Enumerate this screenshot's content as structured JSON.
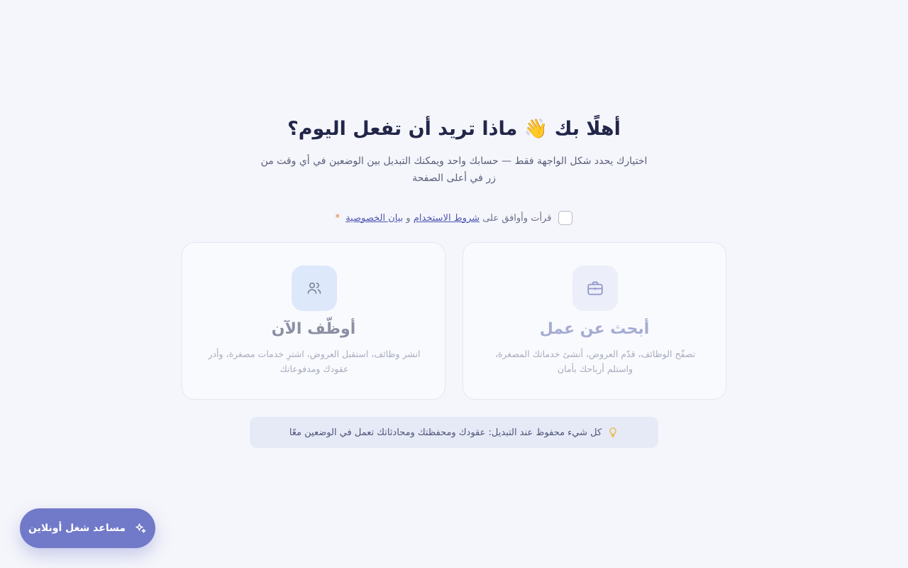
{
  "welcome": {
    "heading": "أهلًا بك 👋 ماذا تريد أن تفعل اليوم؟",
    "subtitle": "اختيارك يحدد شكل الواجهة فقط — حسابك واحد ويمكنك التبديل بين الوضعين في أي وقت من زر في أعلى الصفحة"
  },
  "terms": {
    "prefix": "قرأت وأوافق على",
    "terms_link": "شروط الاستخدام",
    "and": "و",
    "privacy_link": "بيان الخصوصية",
    "required_mark": "*"
  },
  "cards": {
    "job": {
      "icon": "briefcase-icon",
      "title": "أبحث عن عمل",
      "description": "تصفّح الوظائف، قدّم العروض، أنشئ خدماتك المصغرة، واستلم أرباحك بأمان"
    },
    "hire": {
      "icon": "users-icon",
      "title": "أوظّف الآن",
      "description": "انشر وظائف، استقبل العروض، اشترِ خدمات مصغرة، وأدر عقودك ومدفوعاتك"
    }
  },
  "info": {
    "icon": "lightbulb-icon",
    "text": "كل شيء محفوظ عند التبديل: عقودك ومحفظتك ومحادثاتك تعمل في الوضعين معًا"
  },
  "assistant": {
    "icon": "sparkles-icon",
    "label": "مساعد شغل أونلاين"
  },
  "colors": {
    "background": "#f5f6fb",
    "accent": "#7179c9",
    "link": "#4b55b0",
    "required": "#e07a3d",
    "info_bg": "#e6eaf7"
  }
}
